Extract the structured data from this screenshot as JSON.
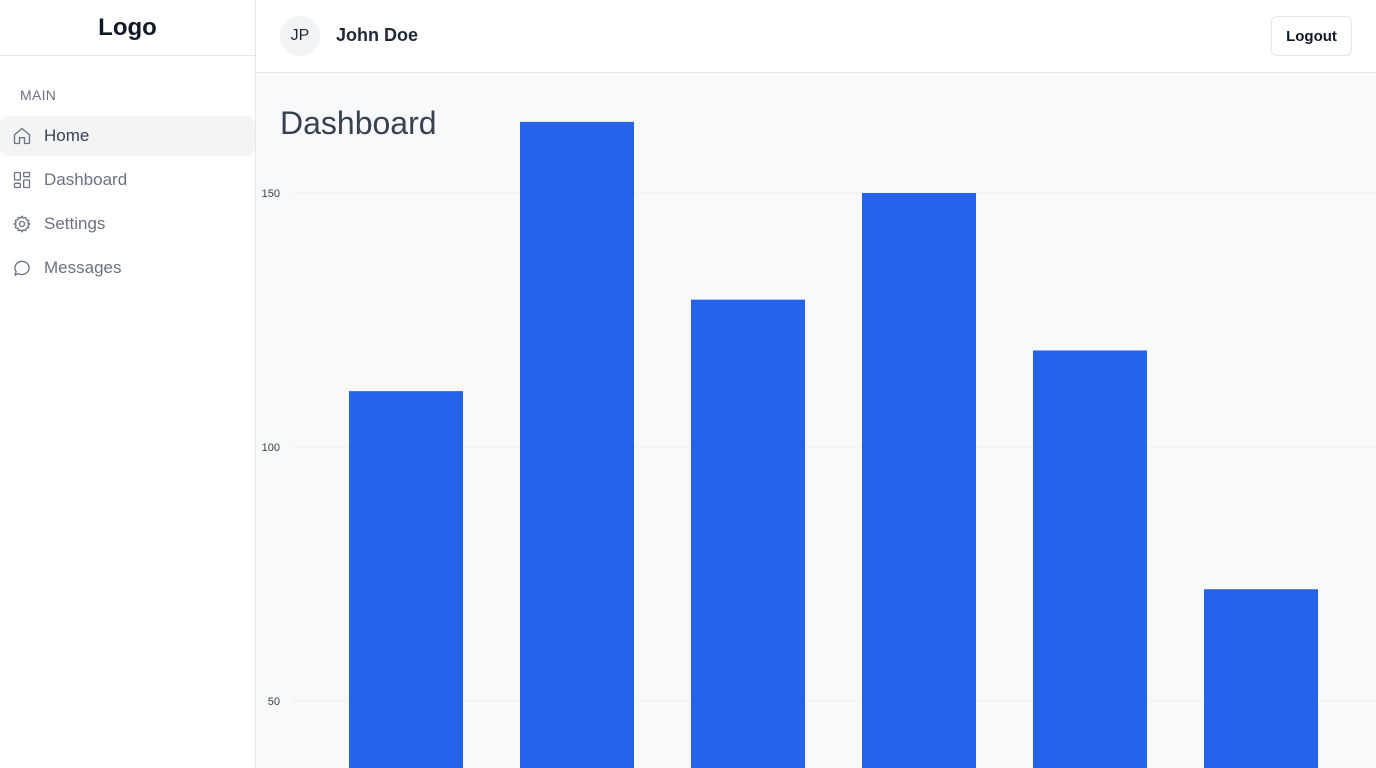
{
  "sidebar": {
    "logo": "Logo",
    "section_label": "MAIN",
    "items": [
      {
        "label": "Home",
        "icon": "home-icon",
        "active": true
      },
      {
        "label": "Dashboard",
        "icon": "dashboard-icon",
        "active": false
      },
      {
        "label": "Settings",
        "icon": "gear-icon",
        "active": false
      },
      {
        "label": "Messages",
        "icon": "message-icon",
        "active": false
      }
    ]
  },
  "header": {
    "avatar_initials": "JP",
    "user_name": "John Doe",
    "logout_label": "Logout"
  },
  "main": {
    "title": "Dashboard"
  },
  "colors": {
    "bar": "#2563eb",
    "grid": "#eef0f3",
    "main_bg": "#f8f9fb"
  },
  "chart_data": {
    "type": "bar",
    "categories": [
      "",
      "",
      "",
      "",
      "",
      ""
    ],
    "values": [
      111,
      164,
      129,
      150,
      119,
      72
    ],
    "yticks": [
      50,
      100,
      150
    ],
    "ylim": [
      40,
      164
    ],
    "grid": true,
    "title": "",
    "xlabel": "",
    "ylabel": ""
  }
}
